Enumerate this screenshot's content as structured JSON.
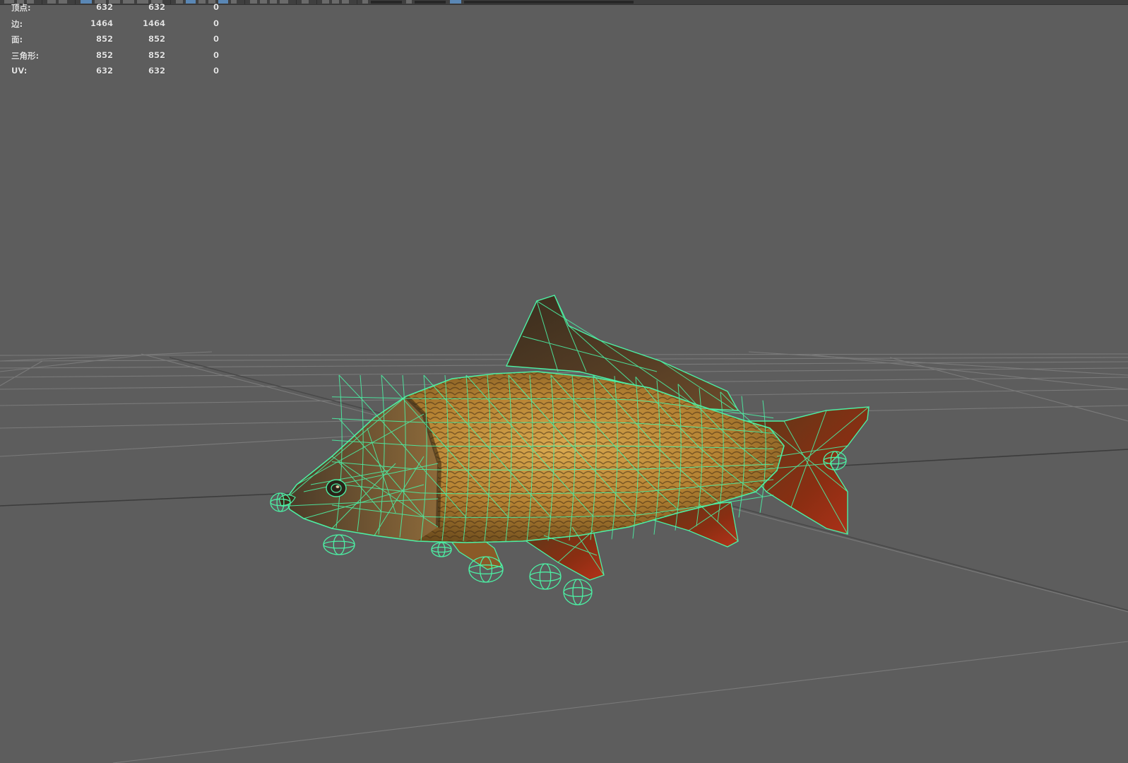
{
  "hud": {
    "rows": [
      {
        "label": "顶点:",
        "values": [
          "632",
          "632",
          "0"
        ]
      },
      {
        "label": "边:",
        "values": [
          "1464",
          "1464",
          "0"
        ]
      },
      {
        "label": "面:",
        "values": [
          "852",
          "852",
          "0"
        ]
      },
      {
        "label": "三角形:",
        "values": [
          "852",
          "852",
          "0"
        ]
      },
      {
        "label": "UV:",
        "values": [
          "632",
          "632",
          "0"
        ]
      }
    ]
  },
  "toolbar": {
    "icons": [
      "move-icon",
      "snap-icon",
      "select-icon",
      "camera-icon",
      "grid-icon",
      "wireframe-icon",
      "shaded-icon",
      "texture-icon",
      "light-icon",
      "shadow-icon",
      "isolate-icon",
      "xray-icon",
      "resolution-icon"
    ]
  },
  "colors": {
    "viewport_bg": "#5d5d5d",
    "grid_line": "#7a7a7a",
    "grid_axis": "#3c3c3c",
    "wireframe": "#4cf0a4",
    "toolbar_bg": "#3f3f3f",
    "highlight": "#5a87b5"
  }
}
